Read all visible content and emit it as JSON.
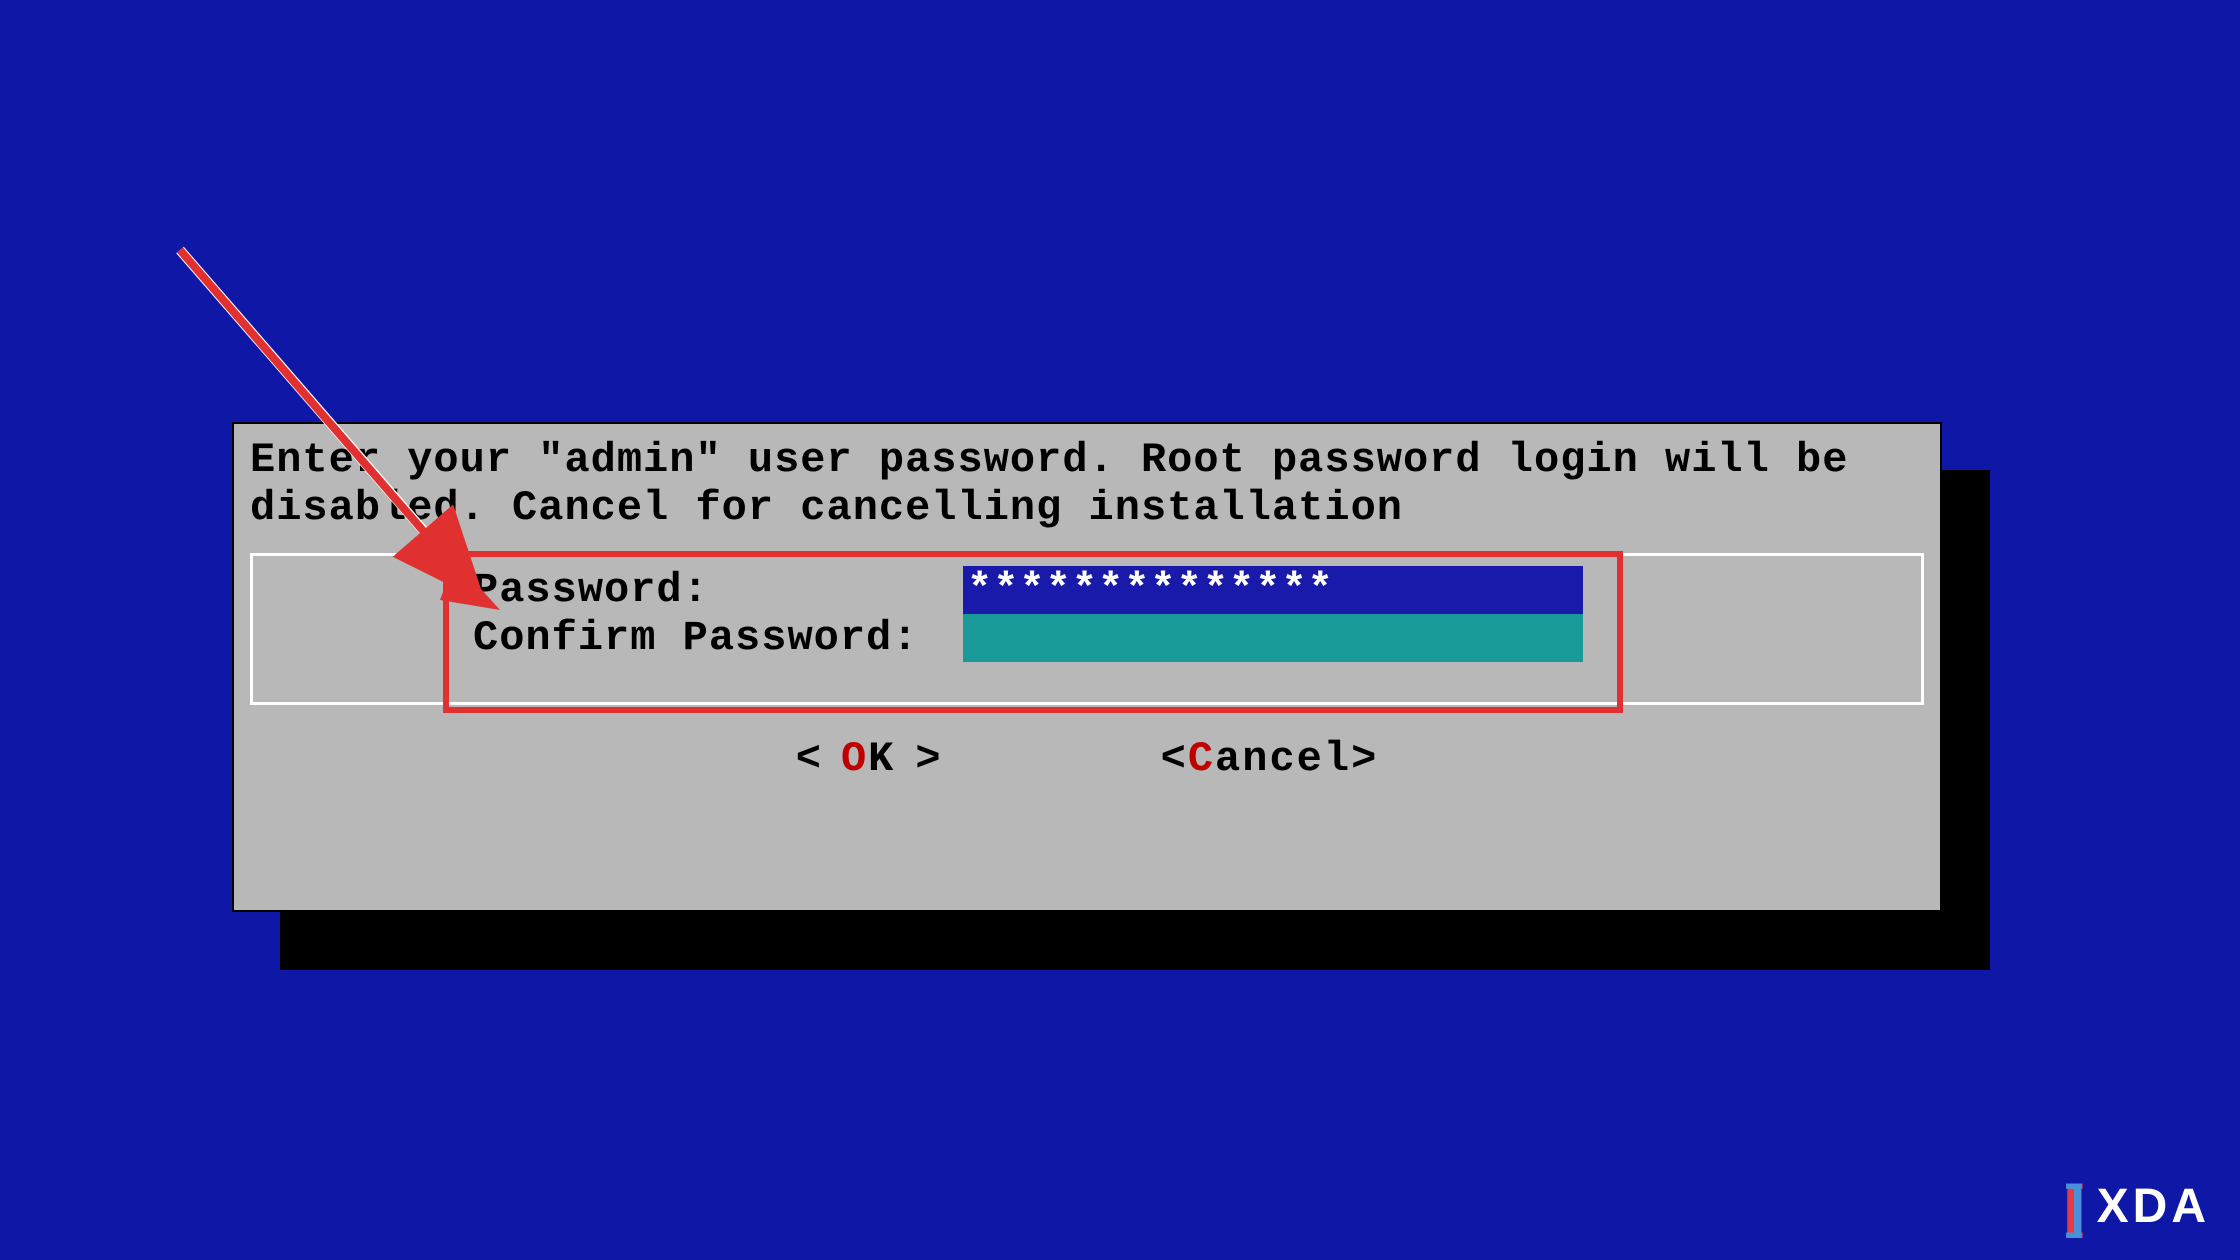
{
  "dialog": {
    "message": "Enter your \"admin\" user password. Root password login will be disabled. Cancel for cancelling installation",
    "form": {
      "password_label": "Password:",
      "password_value": "**************",
      "confirm_label": "Confirm Password:",
      "confirm_value": ""
    },
    "buttons": {
      "ok_bracket_left": "<",
      "ok_hotkey": "O",
      "ok_rest": "K",
      "ok_bracket_right": ">",
      "cancel_bracket_left": "<",
      "cancel_hotkey": "C",
      "cancel_rest": "ancel",
      "cancel_bracket_right": ">"
    }
  },
  "watermark": {
    "text": "XDA"
  }
}
